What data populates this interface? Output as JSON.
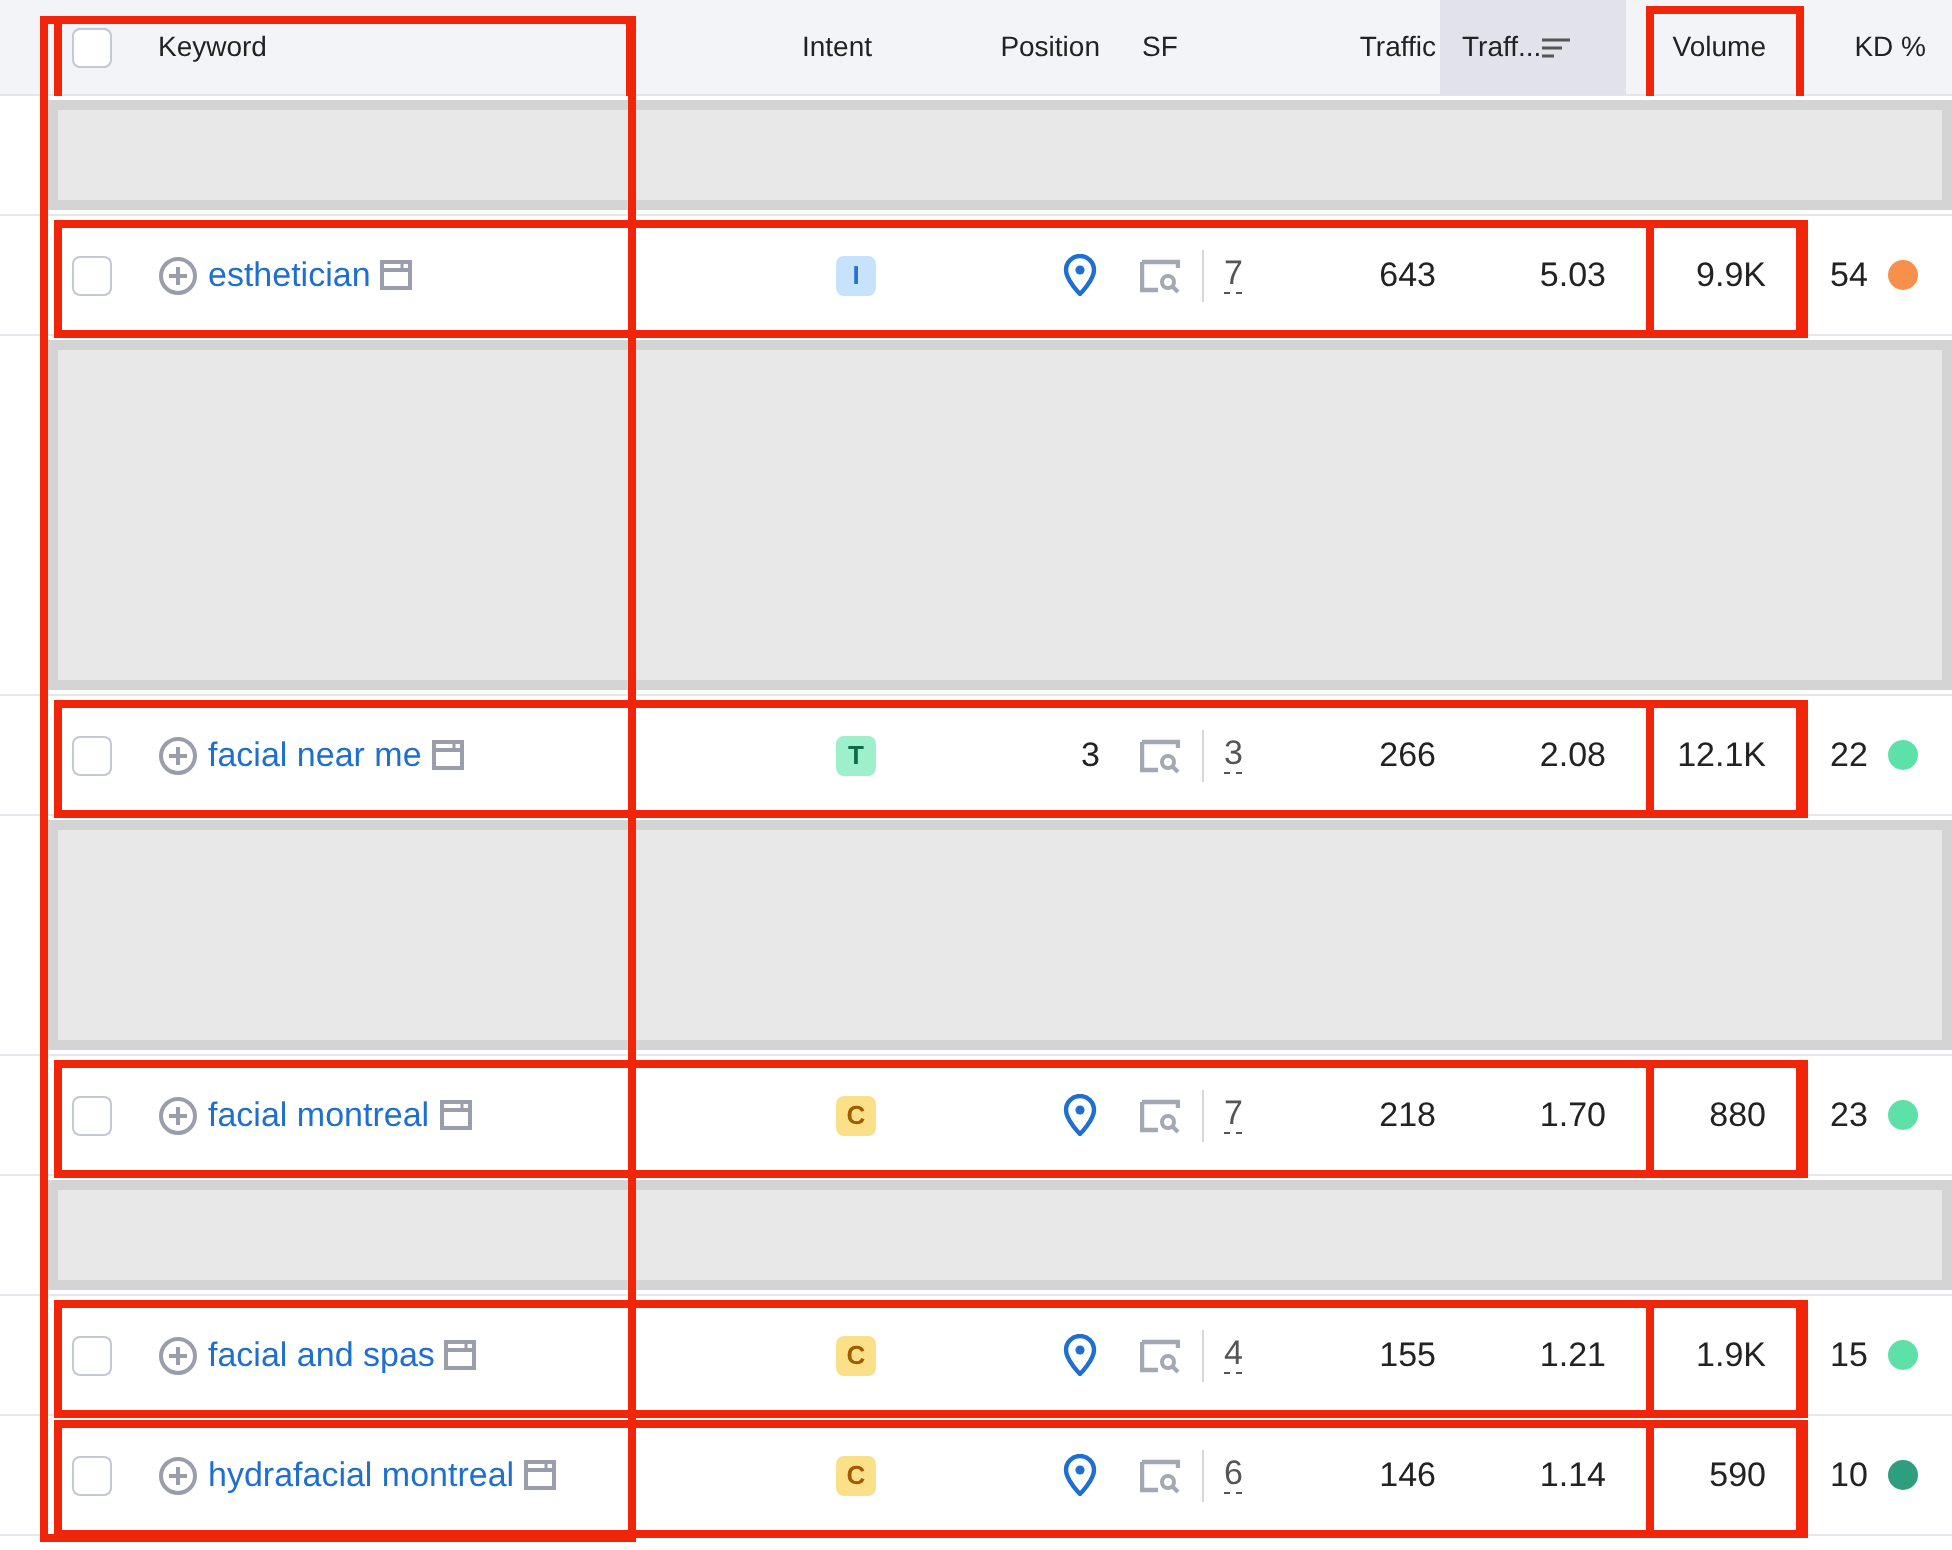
{
  "select_all": {
    "checked": false
  },
  "columns": [
    {
      "label": "Keyword",
      "highlighted": true
    },
    {
      "label": "Intent",
      "highlighted": false
    },
    {
      "label": "Position",
      "highlighted": false
    },
    {
      "label": "SF",
      "highlighted": false
    },
    {
      "label": "Traffic",
      "highlighted": false
    },
    {
      "label": "Traff...",
      "highlighted": false,
      "sorted": true
    },
    {
      "label": "Volume",
      "highlighted": true
    },
    {
      "label": "KD %",
      "highlighted": false
    }
  ],
  "rows": [
    {
      "kind": "redacted"
    },
    {
      "kind": "keyword",
      "checked": false,
      "highlighted": true,
      "keyword": "esthetician",
      "intent": {
        "kind": "informational",
        "label": "I"
      },
      "position": {
        "kind": "local"
      },
      "sf": "7",
      "traffic": "643",
      "traffic_share": "5.03",
      "volume": "9.9K",
      "kd": {
        "value": "54",
        "color": "#f7904a"
      }
    },
    {
      "kind": "redacted"
    },
    {
      "kind": "redacted"
    },
    {
      "kind": "redacted"
    },
    {
      "kind": "keyword",
      "checked": false,
      "highlighted": true,
      "keyword": "facial near me",
      "intent": {
        "kind": "transactional",
        "label": "T"
      },
      "position": {
        "kind": "number",
        "text": "3"
      },
      "sf": "3",
      "traffic": "266",
      "traffic_share": "2.08",
      "volume": "12.1K",
      "kd": {
        "value": "22",
        "color": "#5ee0a9"
      }
    },
    {
      "kind": "redacted"
    },
    {
      "kind": "redacted"
    },
    {
      "kind": "keyword",
      "checked": false,
      "highlighted": true,
      "keyword": "facial montreal",
      "intent": {
        "kind": "commercial",
        "label": "C"
      },
      "position": {
        "kind": "local"
      },
      "sf": "7",
      "traffic": "218",
      "traffic_share": "1.70",
      "volume": "880",
      "kd": {
        "value": "23",
        "color": "#5ee0a9"
      }
    },
    {
      "kind": "redacted"
    },
    {
      "kind": "keyword",
      "checked": false,
      "highlighted": true,
      "keyword": "facial and spas",
      "intent": {
        "kind": "commercial",
        "label": "C"
      },
      "position": {
        "kind": "local"
      },
      "sf": "4",
      "traffic": "155",
      "traffic_share": "1.21",
      "volume": "1.9K",
      "kd": {
        "value": "15",
        "color": "#5ee0a9"
      }
    },
    {
      "kind": "keyword",
      "checked": false,
      "highlighted": true,
      "keyword": "hydrafacial montreal",
      "intent": {
        "kind": "commercial",
        "label": "C"
      },
      "position": {
        "kind": "local"
      },
      "sf": "6",
      "traffic": "146",
      "traffic_share": "1.14",
      "volume": "590",
      "kd": {
        "value": "10",
        "color": "#2e9e7e"
      }
    }
  ]
}
